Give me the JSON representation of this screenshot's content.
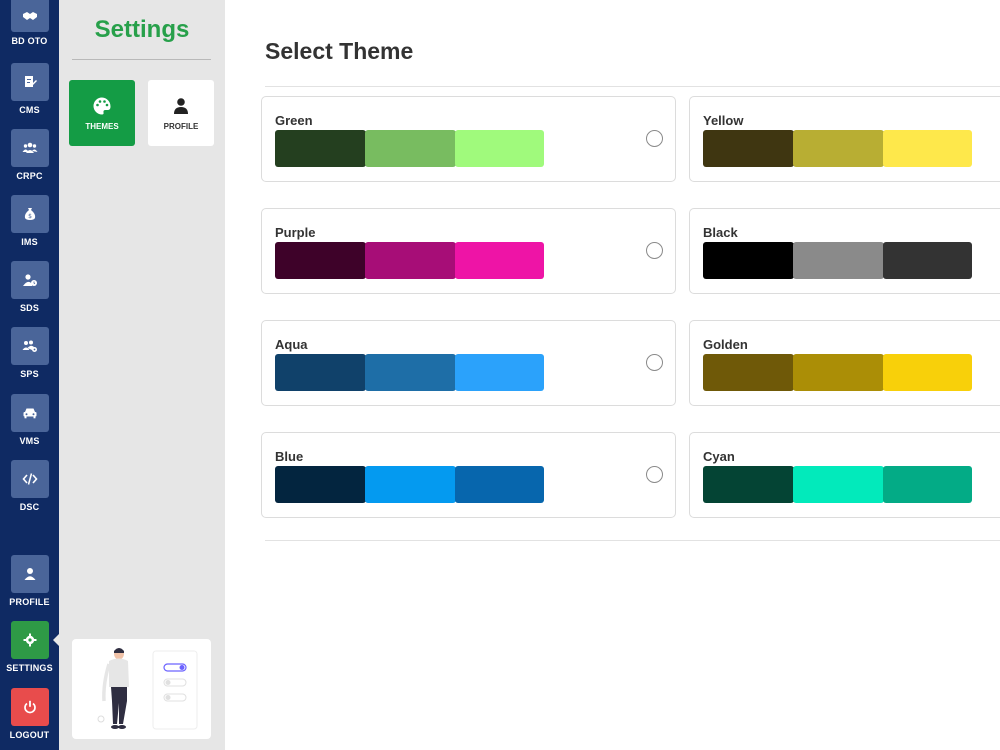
{
  "sidebar": {
    "items": [
      {
        "label": "BD OTO",
        "icon": "handshake-icon"
      },
      {
        "label": "CMS",
        "icon": "document-edit-icon"
      },
      {
        "label": "CRPC",
        "icon": "users-group-icon"
      },
      {
        "label": "IMS",
        "icon": "money-bag-icon"
      },
      {
        "label": "SDS",
        "icon": "user-clock-icon"
      },
      {
        "label": "SPS",
        "icon": "users-cog-icon"
      },
      {
        "label": "VMS",
        "icon": "car-icon"
      },
      {
        "label": "DSC",
        "icon": "code-icon"
      }
    ],
    "bottom": {
      "profile": "PROFILE",
      "settings": "SETTINGS",
      "logout": "LOGOUT"
    }
  },
  "settings_panel": {
    "title": "Settings",
    "tabs": [
      {
        "label": "THEMES",
        "icon": "palette-icon",
        "active": true
      },
      {
        "label": "PROFILE",
        "icon": "user-icon",
        "active": false
      }
    ]
  },
  "main": {
    "title": "Select Theme",
    "themes": [
      {
        "name": "Green",
        "colors": [
          "#243f1f",
          "#78bc60",
          "#a0fa7c"
        ]
      },
      {
        "name": "Yellow",
        "colors": [
          "#3f3611",
          "#b8ae33",
          "#fee84b"
        ]
      },
      {
        "name": "Purple",
        "colors": [
          "#3e0229",
          "#a70d77",
          "#ee14a6"
        ]
      },
      {
        "name": "Black",
        "colors": [
          "#000000",
          "#8a8a8a",
          "#333333"
        ]
      },
      {
        "name": "Aqua",
        "colors": [
          "#10416a",
          "#1e6ea7",
          "#2ba2fb"
        ]
      },
      {
        "name": "Golden",
        "colors": [
          "#6f5908",
          "#ab8e06",
          "#f8d00a"
        ]
      },
      {
        "name": "Blue",
        "colors": [
          "#03253f",
          "#049af0",
          "#0766ad"
        ]
      },
      {
        "name": "Cyan",
        "colors": [
          "#044434",
          "#02eabb",
          "#03ab86"
        ]
      }
    ]
  },
  "colors": {
    "rail_bg": "#0f2a63",
    "rail_button": "#4a6599",
    "settings_active": "#2e9a46",
    "logout": "#e84c4c",
    "panel_bg": "#e6e6e6",
    "panel_title": "#27a04a",
    "themes_tab": "#149c45"
  }
}
